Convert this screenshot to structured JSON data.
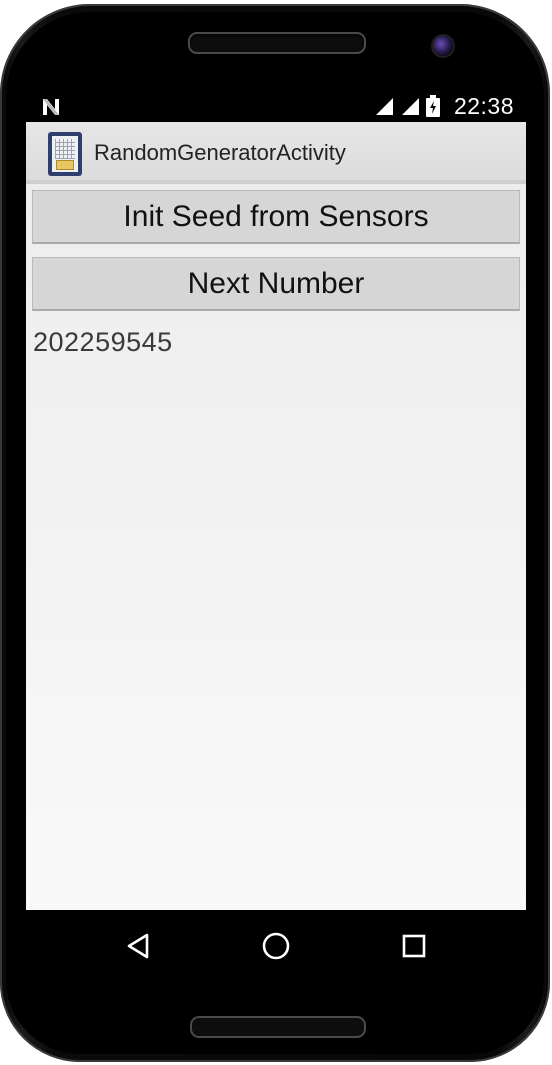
{
  "status_bar": {
    "time": "22:38",
    "icons": [
      "nfc-n-icon",
      "signal-icon",
      "cell-signal-icon",
      "battery-charging-icon"
    ]
  },
  "action_bar": {
    "title": "RandomGeneratorActivity",
    "icon": "app-launcher-icon"
  },
  "main": {
    "init_seed_button": "Init Seed from Sensors",
    "next_number_button": "Next Number",
    "generated_number": "202259545"
  },
  "nav_bar": {
    "items": [
      "back-icon",
      "home-icon",
      "recents-icon"
    ]
  },
  "colors": {
    "action_bar": "#dcdcdc",
    "button_bg": "#d6d6d6",
    "content_bg": "#f2f2f2",
    "status_bar": "#000000"
  }
}
